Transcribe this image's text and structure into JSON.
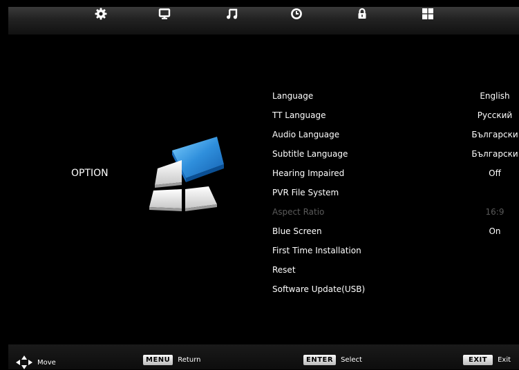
{
  "topbar": {
    "icons": [
      "gear-icon",
      "monitor-icon",
      "music-note-icon",
      "clock-icon",
      "lock-icon",
      "grid-icon"
    ]
  },
  "section_label": "OPTION",
  "menu": [
    {
      "label": "Language",
      "value": "English",
      "enabled": true
    },
    {
      "label": "TT Language",
      "value": "Русский",
      "enabled": true
    },
    {
      "label": "Audio Language",
      "value": "Български",
      "enabled": true
    },
    {
      "label": "Subtitle Language",
      "value": "Български",
      "enabled": true
    },
    {
      "label": "Hearing Impaired",
      "value": "Off",
      "enabled": true
    },
    {
      "label": "PVR File System",
      "value": "",
      "enabled": true
    },
    {
      "label": "Aspect Ratio",
      "value": "16:9",
      "enabled": false
    },
    {
      "label": "Blue Screen",
      "value": "On",
      "enabled": true
    },
    {
      "label": "First Time Installation",
      "value": "",
      "enabled": true
    },
    {
      "label": "Reset",
      "value": "",
      "enabled": true
    },
    {
      "label": "Software Update(USB)",
      "value": "",
      "enabled": true
    }
  ],
  "footer": {
    "move": "Move",
    "menu_key": "MENU",
    "return": "Return",
    "enter_key": "ENTER",
    "select": "Select",
    "exit_key": "EXIT",
    "exit": "Exit"
  },
  "colors": {
    "background": "#000000",
    "disabled_text": "#5a5a5a",
    "accent_blue": "#2f8fdc"
  }
}
